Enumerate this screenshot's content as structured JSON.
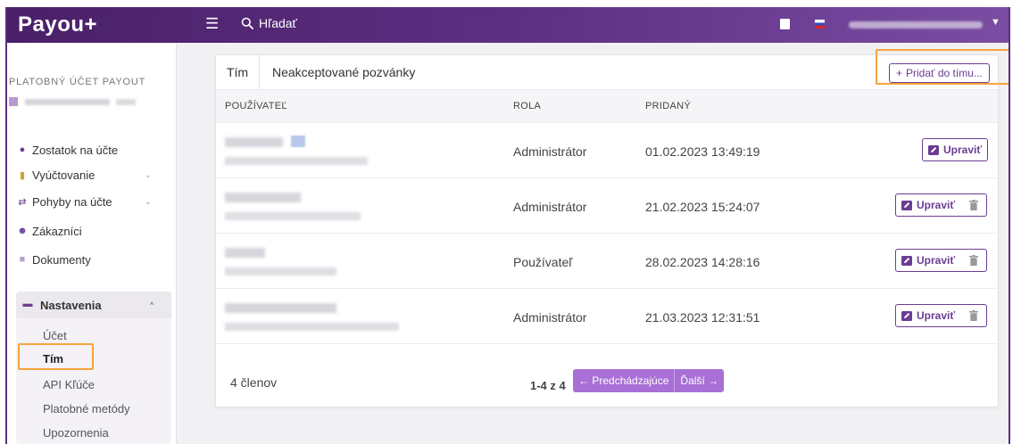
{
  "header": {
    "logo": "Payou+",
    "search_label": "Hľadať",
    "icons": [
      "menu-icon",
      "search-icon",
      "book-icon",
      "flag-sk-icon",
      "chevron-down-icon"
    ]
  },
  "sidebar": {
    "account_title": "PLATOBNÝ ÚČET PAYOUT",
    "items": [
      {
        "label": "Zostatok na účte",
        "icon": "coins-icon"
      },
      {
        "label": "Vyúčtovanie",
        "icon": "invoice-icon"
      },
      {
        "label": "Pohyby na účte",
        "icon": "arrows-icon"
      },
      {
        "label": "Zákazníci",
        "icon": "customer-icon"
      },
      {
        "label": "Dokumenty",
        "icon": "folder-icon"
      }
    ],
    "settings": {
      "label": "Nastavenia",
      "icon": "briefcase-icon",
      "sub_items": [
        "Účet",
        "Tím",
        "API Kľúče",
        "Platobné metódy",
        "Upozornenia"
      ],
      "active": "Tím"
    }
  },
  "main": {
    "tabs": [
      "Tím",
      "Neakceptované pozvánky"
    ],
    "active_tab": "Tím",
    "add_button": "Pridať do tímu...",
    "columns": [
      "POUŽÍVATEĽ",
      "ROLA",
      "PRIDANÝ"
    ],
    "rows": [
      {
        "role": "Administrátor",
        "added": "01.02.2023 13:49:19",
        "edit": "Upraviť",
        "deletable": false
      },
      {
        "role": "Administrátor",
        "added": "21.02.2023 15:24:07",
        "edit": "Upraviť",
        "deletable": true
      },
      {
        "role": "Používateľ",
        "added": "28.02.2023 14:28:16",
        "edit": "Upraviť",
        "deletable": true
      },
      {
        "role": "Administrátor",
        "added": "21.03.2023 12:31:51",
        "edit": "Upraviť",
        "deletable": true
      }
    ],
    "member_count": "4 členov",
    "pagination": {
      "range": "1-4 z 4",
      "prev": "Predchádzajúce",
      "next": "Ďalší"
    }
  },
  "colors": {
    "brand": "#5c2f82",
    "accent": "#a86fd6",
    "highlight": "#f5a43a"
  }
}
